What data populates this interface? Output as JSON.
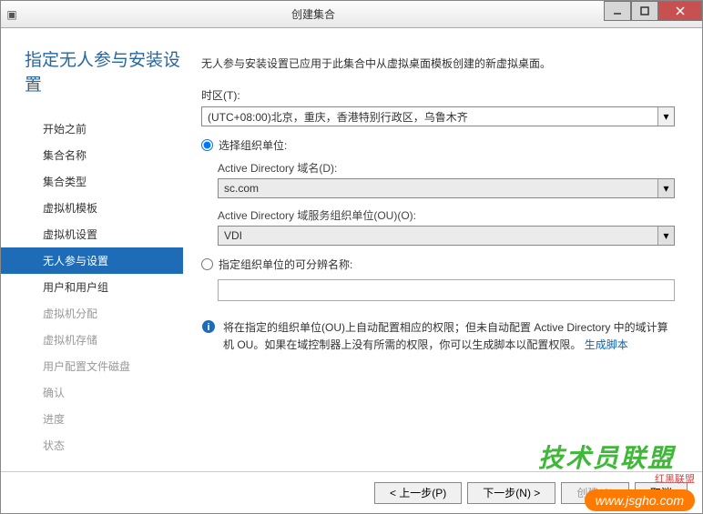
{
  "window": {
    "title": "创建集合"
  },
  "header": {
    "page_title": "指定无人参与安装设置"
  },
  "nav": {
    "items": [
      {
        "label": "开始之前"
      },
      {
        "label": "集合名称"
      },
      {
        "label": "集合类型"
      },
      {
        "label": "虚拟机模板"
      },
      {
        "label": "虚拟机设置"
      },
      {
        "label": "无人参与设置"
      },
      {
        "label": "用户和用户组"
      },
      {
        "label": "虚拟机分配"
      },
      {
        "label": "虚拟机存储"
      },
      {
        "label": "用户配置文件磁盘"
      },
      {
        "label": "确认"
      },
      {
        "label": "进度"
      },
      {
        "label": "状态"
      }
    ],
    "active_index": 5,
    "disabled_from": 7
  },
  "main": {
    "description": "无人参与安装设置已应用于此集合中从虚拟桌面模板创建的新虚拟桌面。",
    "timezone": {
      "label": "时区(T):",
      "value": "(UTC+08:00)北京，重庆，香港特别行政区，乌鲁木齐"
    },
    "radio_select_ou": {
      "label": "选择组织单位:",
      "checked": true
    },
    "ad_domain": {
      "label": "Active Directory 域名(D):",
      "value": "sc.com"
    },
    "ad_ou": {
      "label": "Active Directory 域服务组织单位(OU)(O):",
      "value": "VDI"
    },
    "radio_specify_dn": {
      "label": "指定组织单位的可分辨名称:",
      "checked": false
    },
    "dn_input_value": "",
    "info": {
      "text_before": "将在指定的组织单位(OU)上自动配置相应的权限；但未自动配置 Active Directory 中的域计算机 OU。如果在域控制器上没有所需的权限，你可以生成脚本以配置权限。",
      "link": "生成脚本"
    }
  },
  "footer": {
    "prev": "< 上一步(P)",
    "next": "下一步(N) >",
    "create": "创建(C)",
    "cancel": "取消"
  },
  "watermarks": {
    "w1": "技术员联盟",
    "w2": "www.jsgho.com",
    "w3": "红黑联盟"
  }
}
